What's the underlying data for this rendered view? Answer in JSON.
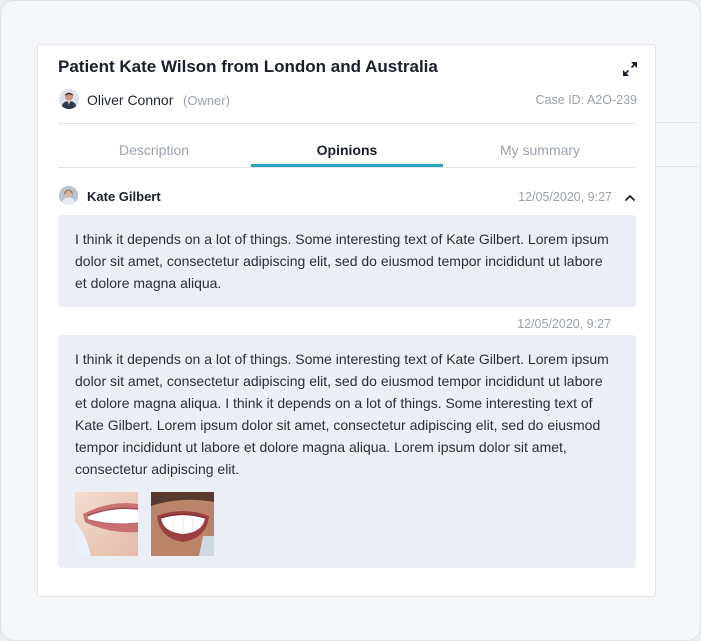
{
  "case": {
    "title": "Patient Kate Wilson from London and Australia",
    "owner_name": "Oliver Connor",
    "owner_role": "(Owner)",
    "case_id": "Case ID: A2O-239"
  },
  "tabs": [
    {
      "label": "Description",
      "active": false
    },
    {
      "label": "Opinions",
      "active": true
    },
    {
      "label": "My summary",
      "active": false
    }
  ],
  "opinions": [
    {
      "author": "Kate Gilbert",
      "date": "12/05/2020, 9:27",
      "text": "I think it depends on a lot of things. Some interesting text of Kate Gilbert. Lorem ipsum dolor sit amet, consectetur adipiscing elit, sed do eiusmod tempor incididunt ut labore et dolore magna aliqua."
    },
    {
      "date": "12/05/2020, 9:27",
      "text": "I think it depends on a lot of things. Some interesting text of Kate Gilbert. Lorem ipsum dolor sit amet, consectetur adipiscing elit, sed do eiusmod tempor incididunt ut labore et dolore magna aliqua. I think it depends on a lot of things. Some interesting text of Kate Gilbert. Lorem ipsum dolor sit amet, consectetur adipiscing elit, sed do eiusmod tempor incididunt ut labore et dolore magna aliqua. Lorem ipsum dolor sit amet, consectetur adipiscing elit.",
      "attachments": [
        "smile-photo",
        "smile-photo"
      ]
    }
  ],
  "icons": {
    "expand": "expand-icon",
    "collapse": "chevron-up-icon"
  },
  "colors": {
    "accent": "#2aa3c3",
    "bubble": "#eceef5",
    "muted": "#9aa1ad"
  }
}
